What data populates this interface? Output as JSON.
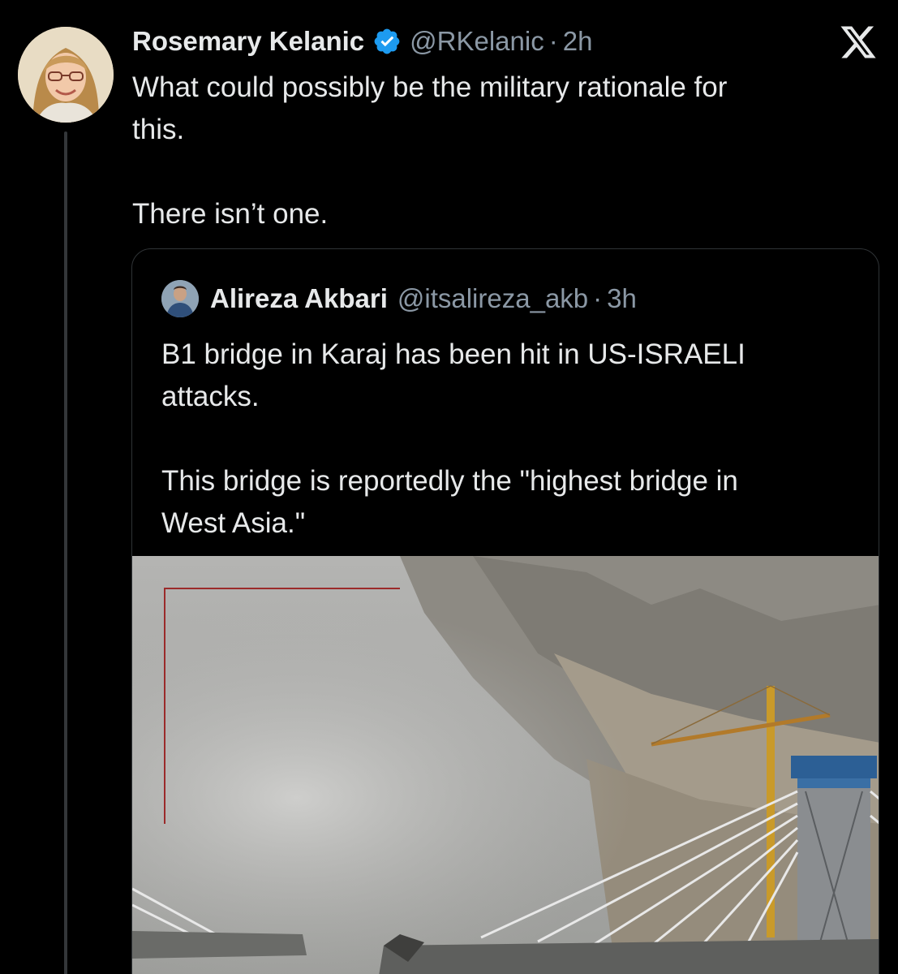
{
  "tweet": {
    "author_name": "Rosemary Kelanic",
    "handle": "@RKelanic",
    "separator": "·",
    "time": "2h",
    "text_lines": [
      "What could possibly be the military rationale for",
      "this."
    ],
    "text_line2": "There isn’t one.",
    "verified_icon": "verified-badge-icon",
    "platform_icon": "x-logo-icon"
  },
  "quote": {
    "author_name": "Alireza Akbari",
    "handle": "@itsalireza_akb",
    "separator": "·",
    "time": "3h",
    "para1_lines": [
      "B1 bridge in Karaj has been hit in US-ISRAELI",
      "attacks."
    ],
    "para2_lines": [
      "This bridge is reportedly the \"highest bridge in",
      "West Asia.\""
    ]
  },
  "colors": {
    "background": "#000000",
    "text": "#e7e9ea",
    "secondary_text": "#8b98a5",
    "verified_blue": "#1d9bf0",
    "border": "#2f3336"
  }
}
